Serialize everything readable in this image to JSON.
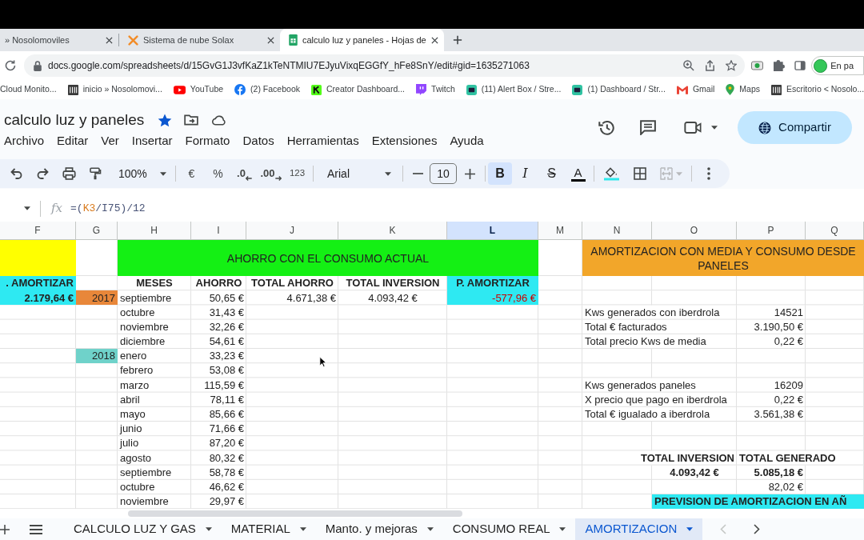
{
  "browser": {
    "tabs": [
      {
        "title": "» Nosolomoviles",
        "kind": "none",
        "selected": false
      },
      {
        "title": "Sistema de nube Solax",
        "kind": "solax",
        "selected": false
      },
      {
        "title": "calculo luz y paneles - Hojas de",
        "kind": "sheets",
        "selected": true
      }
    ],
    "url": "docs.google.com/spreadsheets/d/15GvG1J3vfKaZ1kTeNTMIU7EJyuVixqEGGfY_hFe8SnY/edit#gid=1635271063",
    "profile": "En pa",
    "bookmarks": [
      {
        "label": "Cloud Monito...",
        "kind": "plain"
      },
      {
        "label": "inicio » Nosolomovi...",
        "kind": "site"
      },
      {
        "label": "YouTube",
        "kind": "youtube"
      },
      {
        "label": "(2) Facebook",
        "kind": "facebook"
      },
      {
        "label": "Creator Dashboard...",
        "kind": "kick"
      },
      {
        "label": "Twitch",
        "kind": "twitch"
      },
      {
        "label": "(11) Alert Box / Stre...",
        "kind": "bot"
      },
      {
        "label": "(1) Dashboard / Str...",
        "kind": "bot"
      },
      {
        "label": "Gmail",
        "kind": "gmail"
      },
      {
        "label": "Maps",
        "kind": "maps"
      },
      {
        "label": "Escritorio < Nosolo...",
        "kind": "site"
      }
    ]
  },
  "document": {
    "title": "calculo luz y paneles",
    "starred": true,
    "menu": [
      "Archivo",
      "Editar",
      "Ver",
      "Insertar",
      "Formato",
      "Datos",
      "Herramientas",
      "Extensiones",
      "Ayuda"
    ],
    "share_label": "Compartir"
  },
  "toolbar": {
    "zoom": "100%",
    "currency": "€",
    "percent": "%",
    "decimals_less": ".0",
    "decimals_more": ".00",
    "number_format": "123",
    "font": "Arial",
    "font_size": "10",
    "styles": [
      {
        "label": "B",
        "kind": "bold",
        "selected": true
      },
      {
        "label": "I",
        "kind": "italic",
        "selected": false
      },
      {
        "label": "S",
        "kind": "strike",
        "selected": false
      }
    ],
    "text_color_label": "A",
    "merge_disabled": true
  },
  "formula_bar": {
    "fx": "fx",
    "formula": [
      {
        "text": "=(",
        "color": "#4a5578"
      },
      {
        "text": "K3",
        "color": "#d97b1e"
      },
      {
        "text": "/I75)/12",
        "color": "#4a5578"
      }
    ]
  },
  "sheet": {
    "columns": [
      {
        "label": "F",
        "selected": false
      },
      {
        "label": "G",
        "selected": false
      },
      {
        "label": "H",
        "selected": false
      },
      {
        "label": "I",
        "selected": false
      },
      {
        "label": "J",
        "selected": false
      },
      {
        "label": "K",
        "selected": false
      },
      {
        "label": "L",
        "selected": true
      },
      {
        "label": "M",
        "selected": false
      },
      {
        "label": "N",
        "selected": false
      },
      {
        "label": "O",
        "selected": false
      },
      {
        "label": "P",
        "selected": false
      },
      {
        "label": "Q",
        "selected": false
      }
    ],
    "rows": [
      {
        "cells": [
          {
            "kind": "fill",
            "color": "#ffff00"
          },
          "",
          {
            "kind": "banner",
            "color": "#14f014",
            "text": "AHORRO CON EL CONSUMO ACTUAL",
            "colspan": 5
          },
          "",
          {
            "kind": "banner",
            "color": "#f2a62a",
            "text": "AMORTIZACION CON MEDIA Y CONSUMO DESDE PANELES",
            "colspan": 4
          }
        ]
      },
      {
        "cells": [
          {
            "kind": "heading_right",
            "color": "#2ee9f2",
            "text": ". AMORTIZAR"
          },
          "",
          {
            "kind": "heading",
            "text": "MESES"
          },
          {
            "kind": "heading",
            "text": "AHORRO"
          },
          {
            "kind": "heading",
            "text": "TOTAL AHORRO"
          },
          {
            "kind": "heading",
            "text": "TOTAL INVERSION"
          },
          {
            "kind": "heading",
            "color": "#2ee9f2",
            "text": "P. AMORTIZAR"
          }
        ]
      },
      {
        "cells": [
          {
            "kind": "total",
            "color": "#2ee9f2",
            "text": "2.179,64 €"
          },
          {
            "kind": "year",
            "color": "#e8873a",
            "text": "2017"
          },
          {
            "kind": "month",
            "text": "septiembre"
          },
          {
            "kind": "amount",
            "text": "50,65 €"
          },
          {
            "kind": "amount",
            "text": "4.671,38 €"
          },
          {
            "kind": "centered",
            "text": "4.093,42 €"
          },
          {
            "kind": "negative",
            "color": "#2ee9f2",
            "text": "-577,96 €"
          }
        ]
      },
      {
        "cells": [
          "",
          "",
          {
            "kind": "month",
            "text": "octubre"
          },
          {
            "kind": "amount",
            "text": "31,43 €"
          },
          "",
          "",
          "",
          "",
          {
            "kind": "label",
            "text": "Kws generados con iberdrola",
            "colspan": 2
          },
          {
            "kind": "amount",
            "text": "14521"
          }
        ]
      },
      {
        "cells": [
          "",
          "",
          {
            "kind": "month",
            "text": "noviembre"
          },
          {
            "kind": "amount",
            "text": "32,26 €"
          },
          "",
          "",
          "",
          "",
          {
            "kind": "label",
            "text": "Total € facturados",
            "colspan": 2
          },
          {
            "kind": "amount",
            "text": "3.190,50 €"
          }
        ]
      },
      {
        "cells": [
          "",
          "",
          {
            "kind": "month",
            "text": "diciembre"
          },
          {
            "kind": "amount",
            "text": "54,61 €"
          },
          "",
          "",
          "",
          "",
          {
            "kind": "label",
            "text": "Total precio Kws de media",
            "colspan": 2
          },
          {
            "kind": "amount",
            "text": "0,22 €"
          }
        ]
      },
      {
        "cells": [
          "",
          {
            "kind": "year",
            "color": "#6fd2ca",
            "text": "2018"
          },
          {
            "kind": "month",
            "text": "enero"
          },
          {
            "kind": "amount",
            "text": "33,23 €"
          }
        ]
      },
      {
        "cells": [
          "",
          "",
          {
            "kind": "month",
            "text": "febrero"
          },
          {
            "kind": "amount",
            "text": "53,08 €"
          }
        ]
      },
      {
        "cells": [
          "",
          "",
          {
            "kind": "month",
            "text": "marzo"
          },
          {
            "kind": "amount",
            "text": "115,59 €"
          },
          "",
          "",
          "",
          "",
          {
            "kind": "label",
            "text": "Kws generados paneles",
            "colspan": 2
          },
          {
            "kind": "amount",
            "text": "16209"
          }
        ]
      },
      {
        "cells": [
          "",
          "",
          {
            "kind": "month",
            "text": "abril"
          },
          {
            "kind": "amount",
            "text": "78,11 €"
          },
          "",
          "",
          "",
          "",
          {
            "kind": "label",
            "text": "X precio que pago en iberdrola",
            "colspan": 2
          },
          {
            "kind": "amount",
            "text": "0,22 €"
          }
        ]
      },
      {
        "cells": [
          "",
          "",
          {
            "kind": "month",
            "text": "mayo"
          },
          {
            "kind": "amount",
            "text": "85,66 €"
          },
          "",
          "",
          "",
          "",
          {
            "kind": "label",
            "text": "Total € igualado a iberdrola",
            "colspan": 2
          },
          {
            "kind": "amount",
            "text": "3.561,38 €"
          }
        ]
      },
      {
        "cells": [
          "",
          "",
          {
            "kind": "month",
            "text": "junio"
          },
          {
            "kind": "amount",
            "text": "71,66 €"
          }
        ]
      },
      {
        "cells": [
          "",
          "",
          {
            "kind": "month",
            "text": "julio"
          },
          {
            "kind": "amount",
            "text": "87,20 €"
          }
        ]
      },
      {
        "cells": [
          "",
          "",
          {
            "kind": "month",
            "text": "agosto"
          },
          {
            "kind": "amount",
            "text": "80,32 €"
          },
          "",
          "",
          "",
          "",
          {
            "kind": "heading_right",
            "text": "TOTAL INVERSION",
            "colspan": 2
          },
          {
            "kind": "lead",
            "text": "TOTAL GENERADO",
            "colspan": 2
          }
        ]
      },
      {
        "cells": [
          "",
          "",
          {
            "kind": "month",
            "text": "septiembre"
          },
          {
            "kind": "amount",
            "text": "58,78 €"
          },
          "",
          "",
          "",
          "",
          "",
          {
            "kind": "total_centered",
            "text": "4.093,42 €"
          },
          {
            "kind": "total",
            "text": "5.085,18 €"
          }
        ]
      },
      {
        "cells": [
          "",
          "",
          {
            "kind": "month",
            "text": "octubre"
          },
          {
            "kind": "amount",
            "text": "46,62 €"
          },
          "",
          "",
          "",
          "",
          "",
          "",
          {
            "kind": "amount",
            "text": "82,02 €"
          }
        ]
      },
      {
        "cells": [
          "",
          "",
          {
            "kind": "month",
            "text": "noviembre"
          },
          {
            "kind": "amount",
            "text": "29,97 €"
          },
          "",
          "",
          "",
          "",
          "",
          {
            "kind": "lead",
            "color": "#2ee9f2",
            "text": "PREVISION DE AMORTIZACION EN AÑ",
            "colspan": 3
          }
        ]
      }
    ]
  },
  "sheet_tabs": {
    "tabs": [
      {
        "label": "CALCULO LUZ Y GAS",
        "selected": false
      },
      {
        "label": "MATERIAL",
        "selected": false
      },
      {
        "label": "Manto. y mejoras",
        "selected": false
      },
      {
        "label": "CONSUMO REAL",
        "selected": false
      },
      {
        "label": "AMORTIZACION",
        "selected": true
      }
    ],
    "scroll_left_enabled": false,
    "scroll_right_enabled": true
  }
}
